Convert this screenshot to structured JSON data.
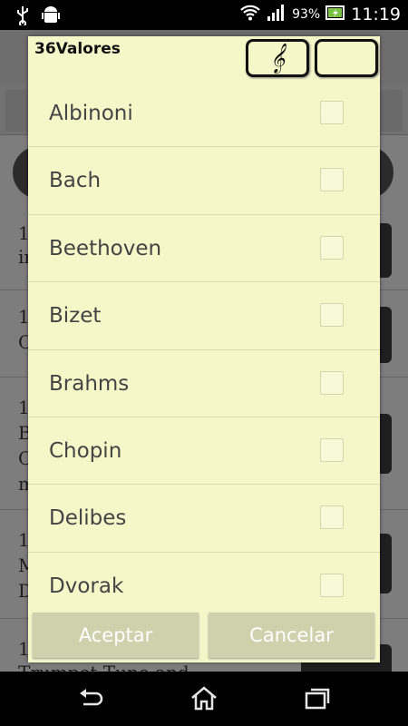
{
  "statusbar": {
    "battery_percent": "93%",
    "time": "11:19"
  },
  "background": {
    "rows": [
      {
        "lines": [
          "1",
          "in"
        ]
      },
      {
        "lines": [
          "1",
          "C"
        ]
      },
      {
        "lines": [
          "1",
          "B",
          "C",
          "m"
        ]
      },
      {
        "lines": [
          "1",
          "M",
          "D"
        ]
      },
      {
        "lines": [
          "1",
          "Trumpet Tune and"
        ]
      }
    ]
  },
  "dialog": {
    "title": "36Valores",
    "composers": [
      {
        "name": "Albinoni",
        "checked": false
      },
      {
        "name": "Bach",
        "checked": false
      },
      {
        "name": "Beethoven",
        "checked": false
      },
      {
        "name": "Bizet",
        "checked": false
      },
      {
        "name": "Brahms",
        "checked": false
      },
      {
        "name": "Chopin",
        "checked": false
      },
      {
        "name": "Delibes",
        "checked": false
      },
      {
        "name": "Dvorak",
        "checked": false
      }
    ],
    "accept_label": "Aceptar",
    "cancel_label": "Cancelar"
  },
  "colors": {
    "dialog_bg": "#f5f7c9",
    "button_bg": "#cfd1ad"
  }
}
